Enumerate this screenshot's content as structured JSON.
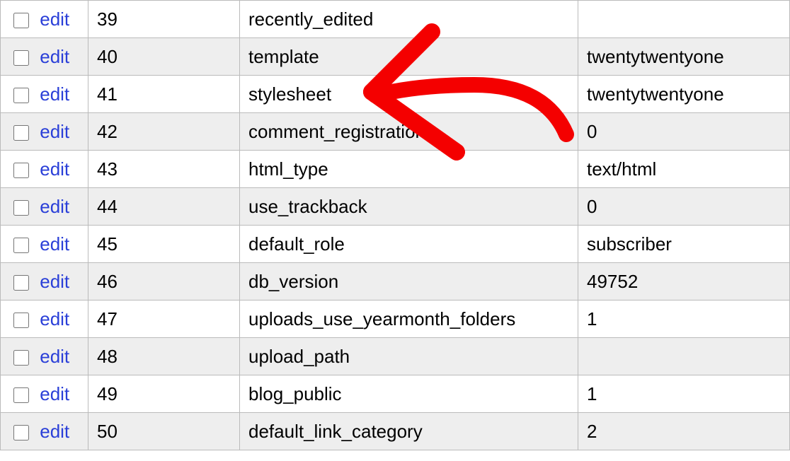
{
  "labels": {
    "edit": "edit"
  },
  "rows": [
    {
      "id": "39",
      "name": "recently_edited",
      "value": ""
    },
    {
      "id": "40",
      "name": "template",
      "value": "twentytwentyone"
    },
    {
      "id": "41",
      "name": "stylesheet",
      "value": "twentytwentyone"
    },
    {
      "id": "42",
      "name": "comment_registration",
      "value": "0"
    },
    {
      "id": "43",
      "name": "html_type",
      "value": "text/html"
    },
    {
      "id": "44",
      "name": "use_trackback",
      "value": "0"
    },
    {
      "id": "45",
      "name": "default_role",
      "value": "subscriber"
    },
    {
      "id": "46",
      "name": "db_version",
      "value": "49752"
    },
    {
      "id": "47",
      "name": "uploads_use_yearmonth_folders",
      "value": "1"
    },
    {
      "id": "48",
      "name": "upload_path",
      "value": ""
    },
    {
      "id": "49",
      "name": "blog_public",
      "value": "1"
    },
    {
      "id": "50",
      "name": "default_link_category",
      "value": "2"
    }
  ]
}
